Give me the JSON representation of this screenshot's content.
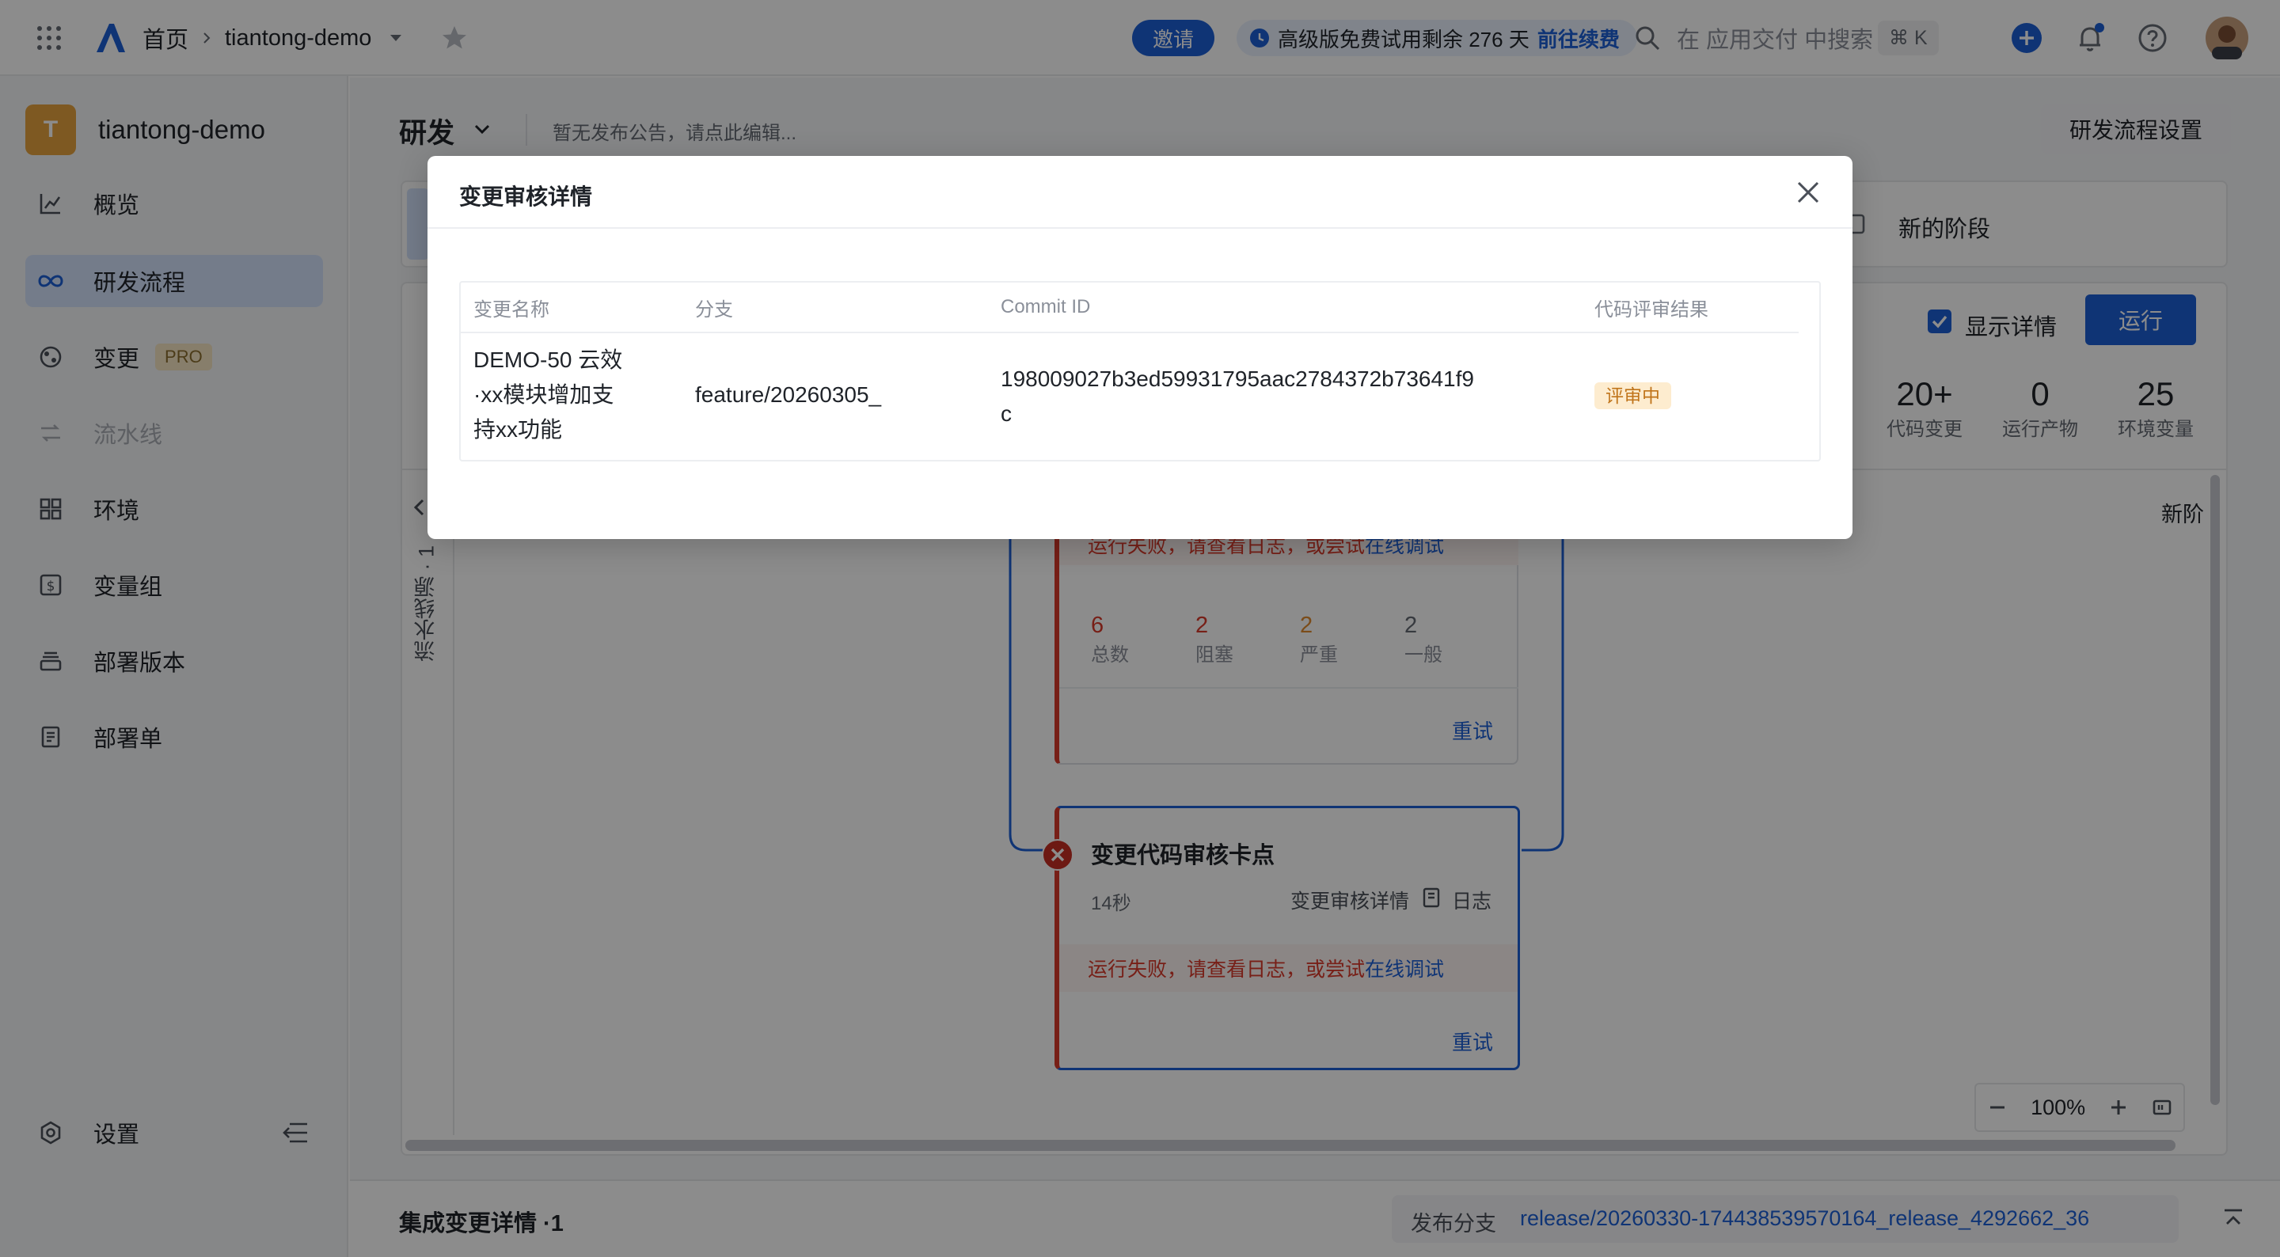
{
  "topbar": {
    "home": "首页",
    "project": "tiantong-demo",
    "invite": "邀请",
    "trial_text": "高级版免费试用剩余 276 天",
    "trial_link": "前往续费",
    "search_placeholder": "在 应用交付 中搜索",
    "shortcut": "⌘ K"
  },
  "sidebar": {
    "logo_letter": "T",
    "project_name": "tiantong-demo",
    "items": [
      {
        "label": "概览",
        "icon": "chart-icon"
      },
      {
        "label": "研发流程",
        "icon": "infinity-icon"
      },
      {
        "label": "变更",
        "icon": "change-icon",
        "badge": "PRO"
      },
      {
        "label": "流水线",
        "icon": "pipeline-icon"
      },
      {
        "label": "环境",
        "icon": "grid-icon"
      },
      {
        "label": "变量组",
        "icon": "dollar-icon"
      },
      {
        "label": "部署版本",
        "icon": "layers-icon"
      },
      {
        "label": "部署单",
        "icon": "document-icon"
      }
    ],
    "settings": "设置"
  },
  "main": {
    "title": "研发",
    "notice": "暂无发布公告，请点此编辑...",
    "settings_button": "研发流程设置",
    "new_stage": "新的阶段",
    "show_details": "显示详情",
    "run_button": "运行",
    "stats": [
      {
        "value": "20+",
        "label": "代码变更"
      },
      {
        "value": "0",
        "label": "运行产物"
      },
      {
        "value": "25",
        "label": "环境变量"
      }
    ],
    "right_stage_label": "新阶",
    "side_label": "流水线源 · 1",
    "card1": {
      "fail_text": "运行失败，请查看日志，或尝试",
      "fail_link": "在线调试",
      "severity": [
        {
          "value": "6",
          "label": "总数"
        },
        {
          "value": "2",
          "label": "阻塞"
        },
        {
          "value": "2",
          "label": "严重"
        },
        {
          "value": "2",
          "label": "一般"
        }
      ],
      "retry": "重试"
    },
    "card2": {
      "title": "变更代码审核卡点",
      "duration": "14秒",
      "detail_link": "变更审核详情",
      "log": "日志",
      "fail_text": "运行失败，请查看日志，或尝试",
      "fail_link": "在线调试",
      "retry": "重试"
    },
    "zoom": "100%",
    "bottom_title": "集成变更详情 ·1",
    "release_label": "发布分支",
    "release_branch": "release/20260330-174438539570164_release_4292662_36"
  },
  "modal": {
    "title": "变更审核详情",
    "columns": [
      "变更名称",
      "分支",
      "Commit ID",
      "代码评审结果"
    ],
    "row": {
      "name_lines": [
        "DEMO-50 云效",
        "·xx模块增加支",
        "持xx功能"
      ],
      "branch": "feature/20260305_",
      "commit_lines": [
        "198009027b3ed59931795aac2784372b73641f9",
        "c"
      ],
      "status": "评审中"
    }
  },
  "colors": {
    "primary": "#1d5fd6",
    "error": "#d93a2b",
    "warning_badge": "#fdeccf"
  }
}
